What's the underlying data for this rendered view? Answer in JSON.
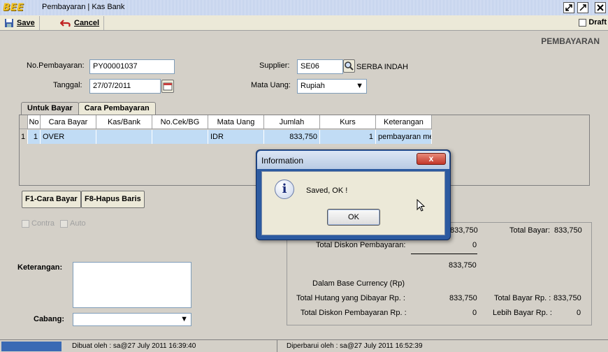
{
  "app": {
    "logo": "BEE",
    "title": "Pembayaran | Kas Bank"
  },
  "toolbar": {
    "save_label": "Save",
    "cancel_label": "Cancel",
    "draft_label": "Draft"
  },
  "page": {
    "heading": "PEMBAYARAN"
  },
  "form": {
    "no_pembayaran_label": "No.Pembayaran:",
    "no_pembayaran_value": "PY00001037",
    "tanggal_label": "Tanggal:",
    "tanggal_value": "27/07/2011",
    "supplier_label": "Supplier:",
    "supplier_code": "SE06",
    "supplier_name": "SERBA INDAH",
    "mata_uang_label": "Mata Uang:",
    "mata_uang_value": "Rupiah"
  },
  "tabs": [
    {
      "label": "Untuk Bayar"
    },
    {
      "label": "Cara Pembayaran"
    }
  ],
  "grid": {
    "columns": [
      "No",
      "Cara Bayar",
      "Kas/Bank",
      "No.Cek/BG",
      "Mata Uang",
      "Jumlah",
      "Kurs",
      "Keterangan"
    ],
    "rows": [
      {
        "row_num": "1",
        "no": "1",
        "cara_bayar": "OVER",
        "kas_bank": "",
        "no_cek": "",
        "mata_uang": "IDR",
        "jumlah": "833,750",
        "kurs": "1",
        "keterangan": "pembayaran me"
      }
    ]
  },
  "buttons": {
    "f1": "F1-Cara Bayar",
    "f8": "F8-Hapus Baris"
  },
  "checkboxes": {
    "contra": "Contra",
    "auto": "Auto"
  },
  "keterangan_label": "Keterangan:",
  "cabang_label": "Cabang:",
  "summary": {
    "top_value": "833,750",
    "total_bayar_label": "Total Bayar:",
    "total_bayar_value": "833,750",
    "total_diskon_label": "Total Diskon Pembayaran:",
    "total_diskon_value": "0",
    "subtotal_value": "833,750",
    "base_currency_label": "Dalam Base Currency (Rp)",
    "total_hutang_label": "Total Hutang yang Dibayar Rp. :",
    "total_hutang_value": "833,750",
    "total_bayar_rp_label": "Total Bayar Rp. :",
    "total_bayar_rp_value": "833,750",
    "total_diskon_rp_label": "Total Diskon Pembayaran Rp. :",
    "total_diskon_rp_value": "0",
    "lebih_bayar_label": "Lebih Bayar Rp. :",
    "lebih_bayar_value": "0"
  },
  "status": {
    "dibuat": "Dibuat oleh : sa@27 July 2011  16:39:40",
    "diperbarui": "Diperbarui oleh : sa@27 July 2011  16:52:39"
  },
  "dialog": {
    "title": "Information",
    "message": "Saved, OK !",
    "ok_label": "OK",
    "close_glyph": "x"
  }
}
